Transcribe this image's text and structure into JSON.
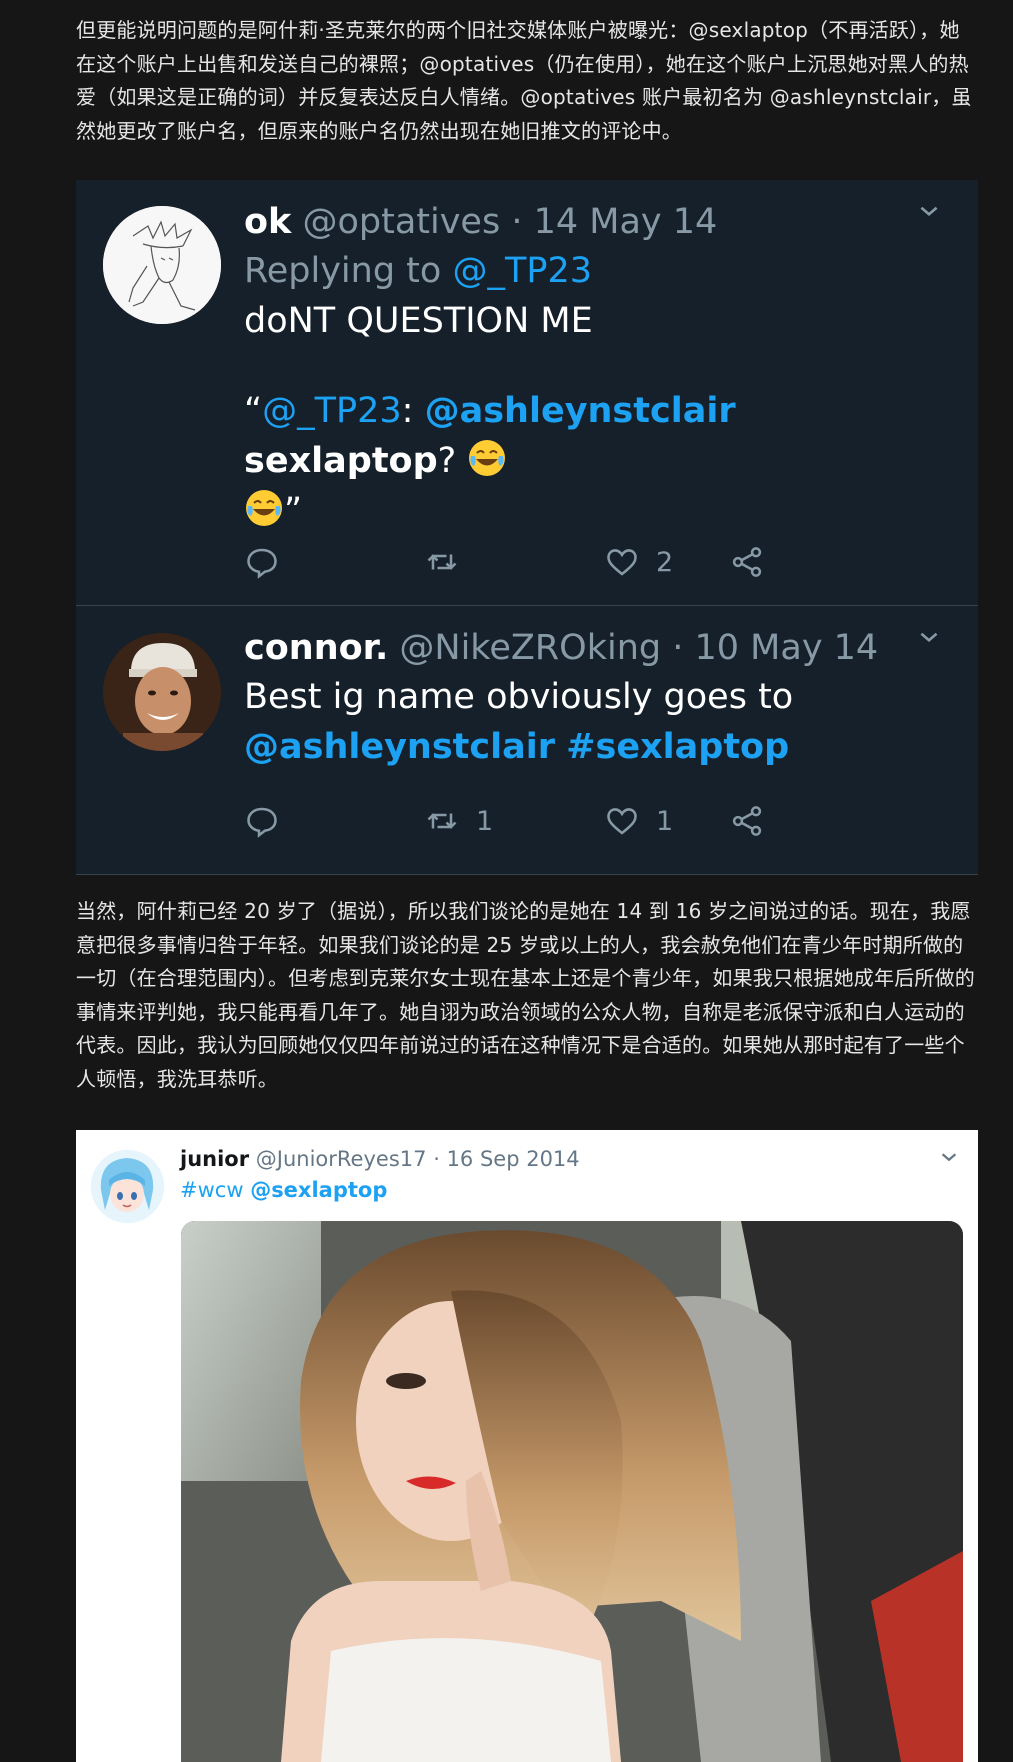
{
  "article": {
    "para1": "但更能说明问题的是阿什莉·圣克莱尔的两个旧社交媒体账户被曝光：@sexlaptop（不再活跃），她在这个账户上出售和发送自己的裸照；@optatives（仍在使用），她在这个账户上沉思她对黑人的热爱（如果这是正确的词）并反复表达反白人情绪。@optatives 账户最初名为 @ashleynstclair，虽然她更改了账户名，但原来的账户名仍然出现在她旧推文的评论中。",
    "para2": "当然，阿什莉已经 20 岁了（据说），所以我们谈论的是她在 14 到 16 岁之间说过的话。现在，我愿意把很多事情归咎于年轻。如果我们谈论的是 25 岁或以上的人，我会赦免他们在青少年时期所做的一切（在合理范围内）。但考虑到克莱尔女士现在基本上还是个青少年，如果我只根据她成年后所做的事情来评判她，我只能再看几年了。她自诩为政治领域的公众人物，自称是老派保守派和白人运动的代表。因此，我认为回顾她仅仅四年前说过的话在这种情况下是合适的。如果她从那时起有了一些个人顿悟，我洗耳恭听。"
  },
  "tweet1": {
    "name": "ok",
    "handle": "@optatives",
    "sep": "·",
    "date": "14 May 14",
    "replying_prefix": "Replying to ",
    "replying_handle": "@_TP23",
    "line1": "doNT QUESTION ME",
    "quote_open": "“",
    "quote_handle": "@_TP23",
    "colon": ": ",
    "mention": "@ashleynstclair",
    "word": "sexlaptop",
    "qmark": "?",
    "quote_close": "”",
    "likes": "2",
    "caret": "⌄"
  },
  "tweet2": {
    "name": "connor.",
    "handle": "@NikeZROking",
    "sep": "·",
    "date": "10 May 14",
    "text": "Best ig name obviously goes to",
    "mention": "@ashleynstclair",
    "hashtag": "#sexlaptop",
    "retweets": "1",
    "likes": "1",
    "caret": "⌄"
  },
  "tweet3": {
    "name": "junior",
    "handle": "@JuniorReyes17",
    "sep": "·",
    "date": "16 Sep 2014",
    "hashtag": "#wcw",
    "mention": "@sexlaptop",
    "caret": "⌄"
  },
  "colors": {
    "page_bg": "#161616",
    "dark_tweet_bg": "#15202b",
    "link": "#1da1f2",
    "muted": "#8899a6"
  }
}
